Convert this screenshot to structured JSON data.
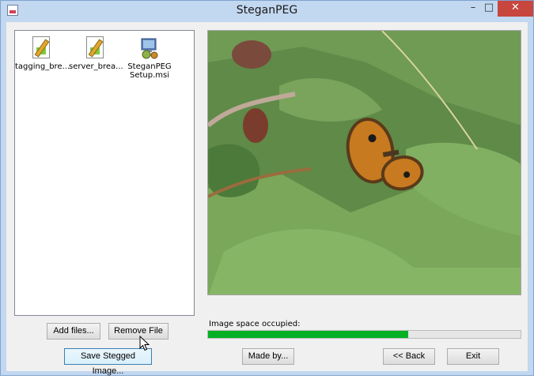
{
  "window": {
    "title": "SteganPEG",
    "minimize_glyph": "–",
    "maximize_glyph": "□",
    "close_glyph": "✕"
  },
  "file_list": {
    "items": [
      {
        "label": "tagging_bre...",
        "icon": "script-file-icon"
      },
      {
        "label": "server_brea...",
        "icon": "script-file-icon"
      },
      {
        "label_line1": "SteganPEG",
        "label_line2": "Setup.msi",
        "icon": "msi-installer-icon"
      }
    ]
  },
  "image_panel": {
    "description_icon": "butterfly-on-leaf-photo"
  },
  "space": {
    "label": "Image space occupied:",
    "fraction": 0.64
  },
  "buttons": {
    "add_files": "Add files...",
    "remove_file": "Remove File",
    "save_stegged": "Save Stegged Image...",
    "made_by": "Made by...",
    "back": "<< Back",
    "exit": "Exit"
  },
  "colors": {
    "progress": "#06b025",
    "titlebar": "#c2d7f0",
    "close": "#c7463d"
  }
}
